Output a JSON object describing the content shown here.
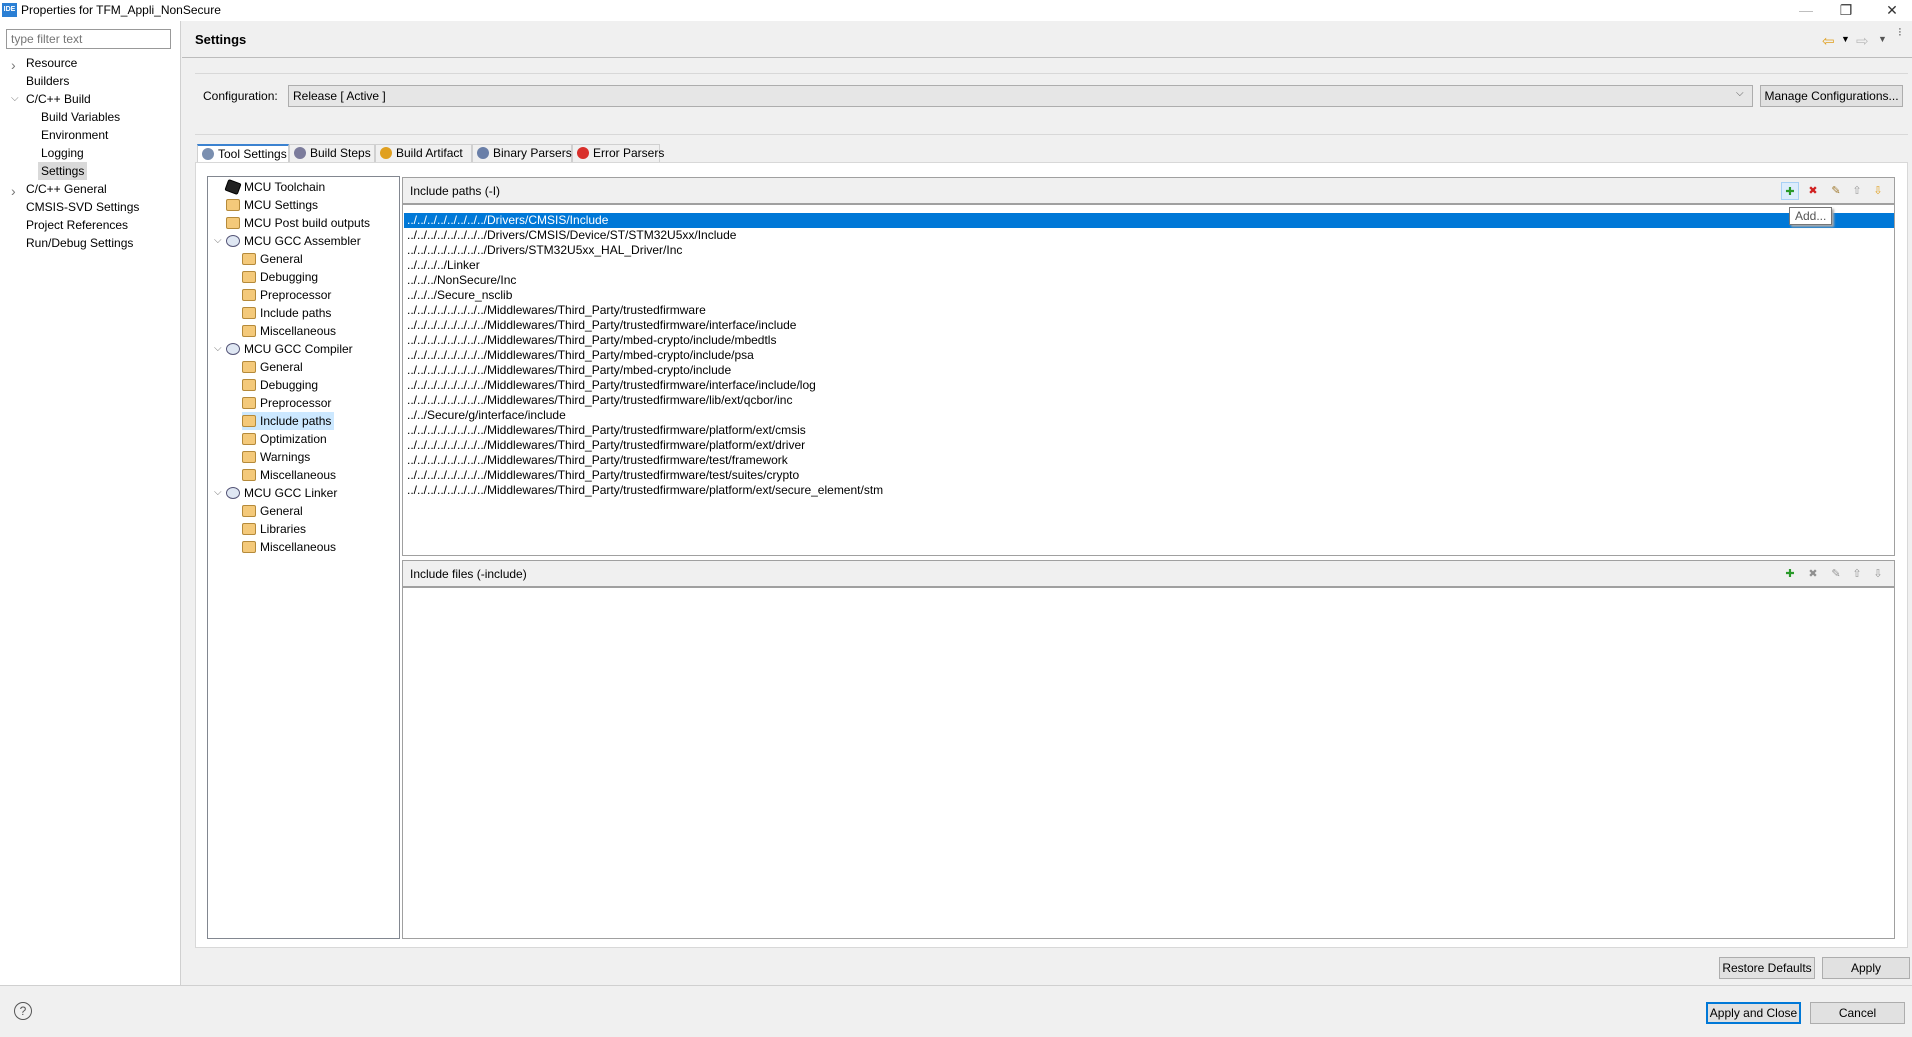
{
  "window": {
    "title": "Properties for TFM_Appli_NonSecure",
    "app_icon": "IDE"
  },
  "nav": {
    "filter_placeholder": "type filter text",
    "items": [
      {
        "label": "Resource",
        "expand": ">"
      },
      {
        "label": "Builders"
      },
      {
        "label": "C/C++ Build",
        "expand": "v"
      },
      {
        "label": "Build Variables"
      },
      {
        "label": "Environment"
      },
      {
        "label": "Logging"
      },
      {
        "label": "Settings",
        "selected": true
      },
      {
        "label": "C/C++ General",
        "expand": ">"
      },
      {
        "label": "CMSIS-SVD Settings"
      },
      {
        "label": "Project References"
      },
      {
        "label": "Run/Debug Settings"
      }
    ]
  },
  "header": {
    "title": "Settings"
  },
  "config": {
    "label": "Configuration:",
    "value": "Release  [ Active ]",
    "manage_label": "Manage Configurations..."
  },
  "tabs": [
    {
      "label": "Tool Settings",
      "active": true,
      "color": "#7a8fb0"
    },
    {
      "label": "Build Steps",
      "color": "#7c7c9c"
    },
    {
      "label": "Build Artifact",
      "color": "#e0a020"
    },
    {
      "label": "Binary Parsers",
      "color": "#6a7fa8"
    },
    {
      "label": "Error Parsers",
      "color": "#d9302c"
    }
  ],
  "tree": [
    {
      "label": "MCU Toolchain",
      "icon": "chip"
    },
    {
      "label": "MCU Settings",
      "icon": "folder"
    },
    {
      "label": "MCU Post build outputs",
      "icon": "folder"
    },
    {
      "label": "MCU GCC Assembler",
      "icon": "tool",
      "expand": "v"
    },
    {
      "label": "General",
      "icon": "folder",
      "child": true
    },
    {
      "label": "Debugging",
      "icon": "folder",
      "child": true
    },
    {
      "label": "Preprocessor",
      "icon": "folder",
      "child": true
    },
    {
      "label": "Include paths",
      "icon": "folder",
      "child": true
    },
    {
      "label": "Miscellaneous",
      "icon": "folder",
      "child": true
    },
    {
      "label": "MCU GCC Compiler",
      "icon": "tool",
      "expand": "v"
    },
    {
      "label": "General",
      "icon": "folder",
      "child": true
    },
    {
      "label": "Debugging",
      "icon": "folder",
      "child": true
    },
    {
      "label": "Preprocessor",
      "icon": "folder",
      "child": true
    },
    {
      "label": "Include paths",
      "icon": "folder",
      "child": true,
      "selected": true
    },
    {
      "label": "Optimization",
      "icon": "folder",
      "child": true
    },
    {
      "label": "Warnings",
      "icon": "folder",
      "child": true
    },
    {
      "label": "Miscellaneous",
      "icon": "folder",
      "child": true
    },
    {
      "label": "MCU GCC Linker",
      "icon": "tool",
      "expand": "v"
    },
    {
      "label": "General",
      "icon": "folder",
      "child": true
    },
    {
      "label": "Libraries",
      "icon": "folder",
      "child": true
    },
    {
      "label": "Miscellaneous",
      "icon": "folder",
      "child": true
    }
  ],
  "include_paths": {
    "title": "Include paths (-I)",
    "tooltip": "Add...",
    "items": [
      "../../../../../../../../Drivers/CMSIS/Include",
      "../../../../../../../../Drivers/CMSIS/Device/ST/STM32U5xx/Include",
      "../../../../../../../../Drivers/STM32U5xx_HAL_Driver/Inc",
      "../../../../Linker",
      "../../../NonSecure/Inc",
      "../../../Secure_nsclib",
      "../../../../../../../../Middlewares/Third_Party/trustedfirmware",
      "../../../../../../../../Middlewares/Third_Party/trustedfirmware/interface/include",
      "../../../../../../../../Middlewares/Third_Party/mbed-crypto/include/mbedtls",
      "../../../../../../../../Middlewares/Third_Party/mbed-crypto/include/psa",
      "../../../../../../../../Middlewares/Third_Party/mbed-crypto/include",
      "../../../../../../../../Middlewares/Third_Party/trustedfirmware/interface/include/log",
      "../../../../../../../../Middlewares/Third_Party/trustedfirmware/lib/ext/qcbor/inc",
      "../../Secure/g/interface/include",
      "../../../../../../../../Middlewares/Third_Party/trustedfirmware/platform/ext/cmsis",
      "../../../../../../../../Middlewares/Third_Party/trustedfirmware/platform/ext/driver",
      "../../../../../../../../Middlewares/Third_Party/trustedfirmware/test/framework",
      "../../../../../../../../Middlewares/Third_Party/trustedfirmware/test/suites/crypto",
      "../../../../../../../../Middlewares/Third_Party/trustedfirmware/platform/ext/secure_element/stm"
    ]
  },
  "include_files": {
    "title": "Include files (-include)",
    "items": []
  },
  "toolbar_icons": [
    "add-icon",
    "delete-icon",
    "edit-icon",
    "move-up-icon",
    "move-down-icon"
  ],
  "buttons": {
    "restore_defaults": "Restore Defaults",
    "apply": "Apply",
    "apply_close": "Apply and Close",
    "cancel": "Cancel",
    "help": "?"
  }
}
